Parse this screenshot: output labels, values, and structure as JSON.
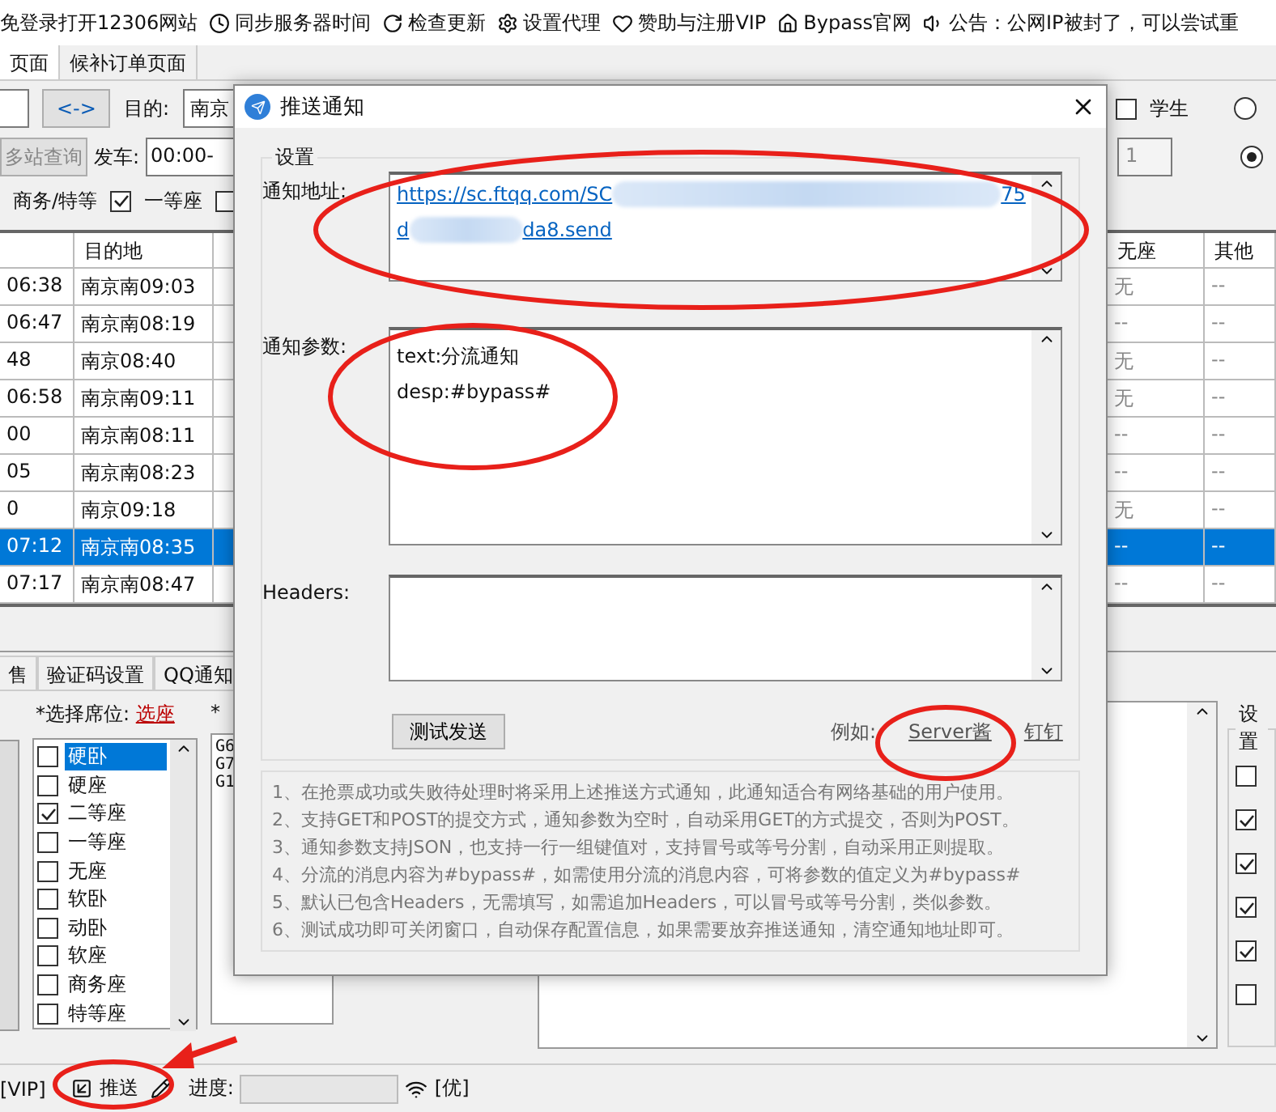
{
  "toolbar": [
    "免登录打开12306网站",
    "同步服务器时间",
    "检查更新",
    "设置代理",
    "赞助与注册VIP",
    "Bypass官网",
    "公告：公网IP被封了，可以尝试重"
  ],
  "tabs": [
    {
      "label": "页面",
      "selected": true
    },
    {
      "label": "候补订单页面",
      "selected": false
    }
  ],
  "query": {
    "swap_button": "<->",
    "to_label": "目的:",
    "to_value": "南京",
    "multi_button": "多站查询",
    "depart_label": "发车:",
    "depart_value": "00:00-",
    "student": {
      "label": "学生",
      "checked": false
    },
    "count_value": "1",
    "radios": [
      {
        "selected": false
      },
      {
        "selected": true
      }
    ],
    "seat_filters": [
      {
        "kind": "label",
        "label": "商务/特等"
      },
      {
        "kind": "check",
        "label": "一等座",
        "checked": true
      },
      {
        "kind": "check",
        "checked": false
      }
    ]
  },
  "table": {
    "columns": [
      "目的地",
      "无座",
      "其他"
    ],
    "rows": [
      {
        "column_1": "06:38",
        "arrive": "南京南09:03",
        "no_seat": "无",
        "other": "--",
        "selected": false
      },
      {
        "column_1": "06:47",
        "arrive": "南京南08:19",
        "no_seat": "--",
        "other": "--",
        "selected": false
      },
      {
        "column_1": "48",
        "arrive": "南京08:40",
        "no_seat": "无",
        "other": "--",
        "selected": false
      },
      {
        "column_1": "06:58",
        "arrive": "南京南09:11",
        "no_seat": "无",
        "other": "--",
        "selected": false
      },
      {
        "column_1": "00",
        "arrive": "南京南08:11",
        "no_seat": "--",
        "other": "--",
        "selected": false
      },
      {
        "column_1": "05",
        "arrive": "南京南08:23",
        "no_seat": "--",
        "other": "--",
        "selected": false
      },
      {
        "column_1": "0",
        "arrive": "南京09:18",
        "no_seat": "无",
        "other": "--",
        "selected": false
      },
      {
        "column_1": "07:12",
        "arrive": "南京南08:35",
        "no_seat": "--",
        "other": "--",
        "selected": true
      },
      {
        "column_1": "07:17",
        "arrive": "南京南08:47",
        "no_seat": "--",
        "other": "--",
        "selected": false
      }
    ]
  },
  "bottom": {
    "tabs": [
      "售",
      "验证码设置",
      "QQ通知"
    ],
    "seat_label": "*选择席位:",
    "seat_link": "选座",
    "cut_label": "*",
    "seats": [
      {
        "label": "硬卧",
        "checked": false,
        "selected": true
      },
      {
        "label": "硬座",
        "checked": false,
        "selected": false
      },
      {
        "label": "二等座",
        "checked": true,
        "selected": false
      },
      {
        "label": "一等座",
        "checked": false,
        "selected": false
      },
      {
        "label": "无座",
        "checked": false,
        "selected": false
      },
      {
        "label": "软卧",
        "checked": false,
        "selected": false
      },
      {
        "label": "动卧",
        "checked": false,
        "selected": false
      },
      {
        "label": "软座",
        "checked": false,
        "selected": false
      },
      {
        "label": "商务座",
        "checked": false,
        "selected": false
      },
      {
        "label": "特等座",
        "checked": false,
        "selected": false
      }
    ],
    "trains": [
      "G6",
      "G7",
      "G1"
    ],
    "settings_title": "设置",
    "settings_checks": [
      {
        "checked": false
      },
      {
        "checked": true
      },
      {
        "checked": true
      },
      {
        "checked": true
      },
      {
        "checked": true
      },
      {
        "checked": false
      }
    ]
  },
  "status_bar": {
    "vip": "[VIP]",
    "push": "推送",
    "progress_label": "进度:",
    "progress": {
      "level": 0
    },
    "quality": "[优]"
  },
  "dialog": {
    "title": "推送通知",
    "group": "设置",
    "url_label": "通知地址:",
    "url_line_1": [
      "https://sc.ftqq.com/SC",
      "75"
    ],
    "url_line_2": [
      "d",
      "da8.send"
    ],
    "params_label": "通知参数:",
    "params": [
      "text:分流通知",
      "desp:#bypass#"
    ],
    "headers_label": "Headers:",
    "test_button": "测试发送",
    "example_label": "例如:",
    "links": [
      "Server酱",
      "钉钉"
    ],
    "notes": [
      "1、在抢票成功或失败待处理时将采用上述推送方式通知，此通知适合有网络基础的用户使用。",
      "2、支持GET和POST的提交方式，通知参数为空时，自动采用GET的方式提交，否则为POST。",
      "3、通知参数支持JSON，也支持一行一组键值对，支持冒号或等号分割，自动采用正则提取。",
      "4、分流的消息内容为#bypass#，如需使用分流的消息内容，可将参数的值定义为#bypass#",
      "5、默认已包含Headers，无需填写，如需追加Headers，可以冒号或等号分割，类似参数。",
      "6、测试成功即可关闭窗口，自动保存配置信息，如果需要放弃推送通知，清空通知地址即可。"
    ]
  }
}
